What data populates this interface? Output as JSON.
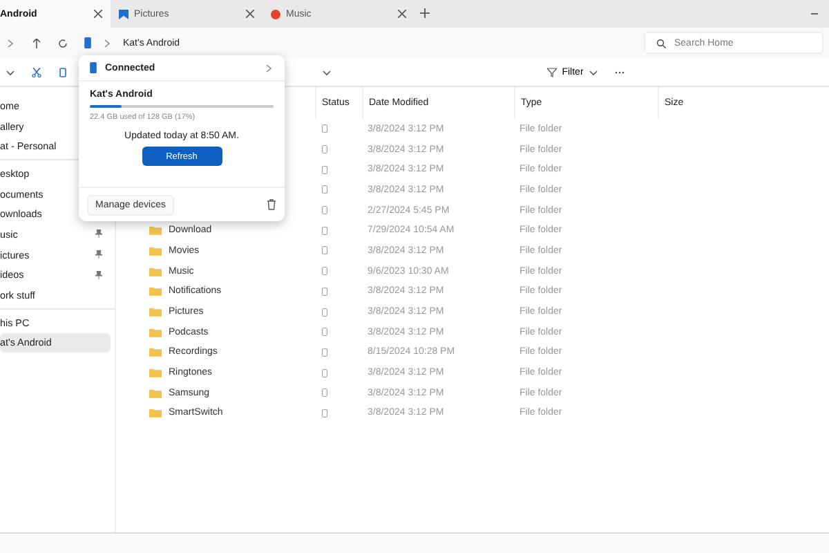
{
  "tabs": [
    {
      "label": "Android",
      "kind": "plain",
      "selected": true
    },
    {
      "label": "Pictures",
      "kind": "pictures",
      "selected": false
    },
    {
      "label": "Music",
      "kind": "music",
      "selected": false
    }
  ],
  "address": {
    "path": "Kat's Android",
    "search_placeholder": "Search Home"
  },
  "toolbar": {
    "filter": "Filter"
  },
  "sidebar": {
    "groups": [
      [
        {
          "label": "ome",
          "pinned": false,
          "selected": false
        },
        {
          "label": "allery",
          "pinned": false,
          "selected": false
        },
        {
          "label": "at - Personal",
          "pinned": false,
          "selected": false
        }
      ],
      [
        {
          "label": "esktop",
          "pinned": false,
          "selected": false
        },
        {
          "label": "ocuments",
          "pinned": false,
          "selected": false
        },
        {
          "label": "ownloads",
          "pinned": false,
          "selected": false
        },
        {
          "label": "usic",
          "pinned": true,
          "selected": false
        },
        {
          "label": "ictures",
          "pinned": true,
          "selected": false
        },
        {
          "label": "ideos",
          "pinned": true,
          "selected": false
        },
        {
          "label": "ork stuff",
          "pinned": false,
          "selected": false
        }
      ],
      [
        {
          "label": "his PC",
          "pinned": false,
          "selected": false
        },
        {
          "label": "at's Android",
          "pinned": false,
          "selected": true
        }
      ]
    ]
  },
  "table": {
    "columns": [
      "Status",
      "Date Modified",
      "Type",
      "Size"
    ],
    "rows": [
      {
        "date": "3/8/2024 3:12 PM",
        "type": "File folder"
      },
      {
        "date": "3/8/2024 3:12 PM",
        "type": "File folder"
      },
      {
        "date": "3/8/2024 3:12 PM",
        "type": "File folder"
      },
      {
        "date": "3/8/2024 3:12 PM",
        "type": "File folder"
      },
      {
        "date": "2/27/2024 5:45 PM",
        "type": "File folder"
      },
      {
        "name": "Download",
        "date": "7/29/2024 10:54 AM",
        "type": "File folder"
      },
      {
        "name": "Movies",
        "date": "3/8/2024 3:12 PM",
        "type": "File folder"
      },
      {
        "name": "Music",
        "date": "9/6/2023 10:30 AM",
        "type": "File folder"
      },
      {
        "name": "Notifications",
        "date": "3/8/2024 3:12 PM",
        "type": "File folder"
      },
      {
        "name": "Pictures",
        "date": "3/8/2024 3:12 PM",
        "type": "File folder"
      },
      {
        "name": "Podcasts",
        "date": "3/8/2024 3:12 PM",
        "type": "File folder"
      },
      {
        "name": "Recordings",
        "date": "8/15/2024 10:28 PM",
        "type": "File folder"
      },
      {
        "name": "Ringtones",
        "date": "3/8/2024 3:12 PM",
        "type": "File folder"
      },
      {
        "name": "Samsung",
        "date": "3/8/2024 3:12 PM",
        "type": "File folder"
      },
      {
        "name": "SmartSwitch",
        "date": "3/8/2024 3:12 PM",
        "type": "File folder"
      }
    ]
  },
  "popup": {
    "title": "Connected",
    "device": "Kat's Android",
    "level": 0.17,
    "usage": "22.4 GB used of 128 GB (17%)",
    "updated": "Updated today at 8:50 AM.",
    "refresh": "Refresh",
    "manage": "Manage devices"
  }
}
